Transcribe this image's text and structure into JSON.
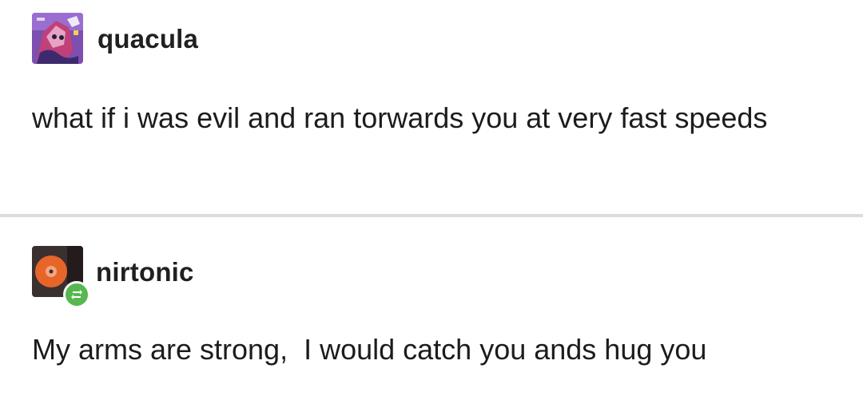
{
  "posts": [
    {
      "username": "quacula",
      "avatar_icon": "anime-character-avatar-icon",
      "text": "what if i was evil and ran torwards you at very fast speeds"
    },
    {
      "username": "nirtonic",
      "avatar_icon": "orange-record-avatar-icon",
      "badge_icon": "reblog-icon",
      "text": "My arms are strong,  I would catch you ands hug you"
    }
  ],
  "colors": {
    "reblog_badge": "#56b84f",
    "divider": "#dcdcdc",
    "avatar1_bg": "#7c4fb0",
    "avatar2_bg": "#3a3030",
    "avatar2_disc": "#e8652a"
  }
}
